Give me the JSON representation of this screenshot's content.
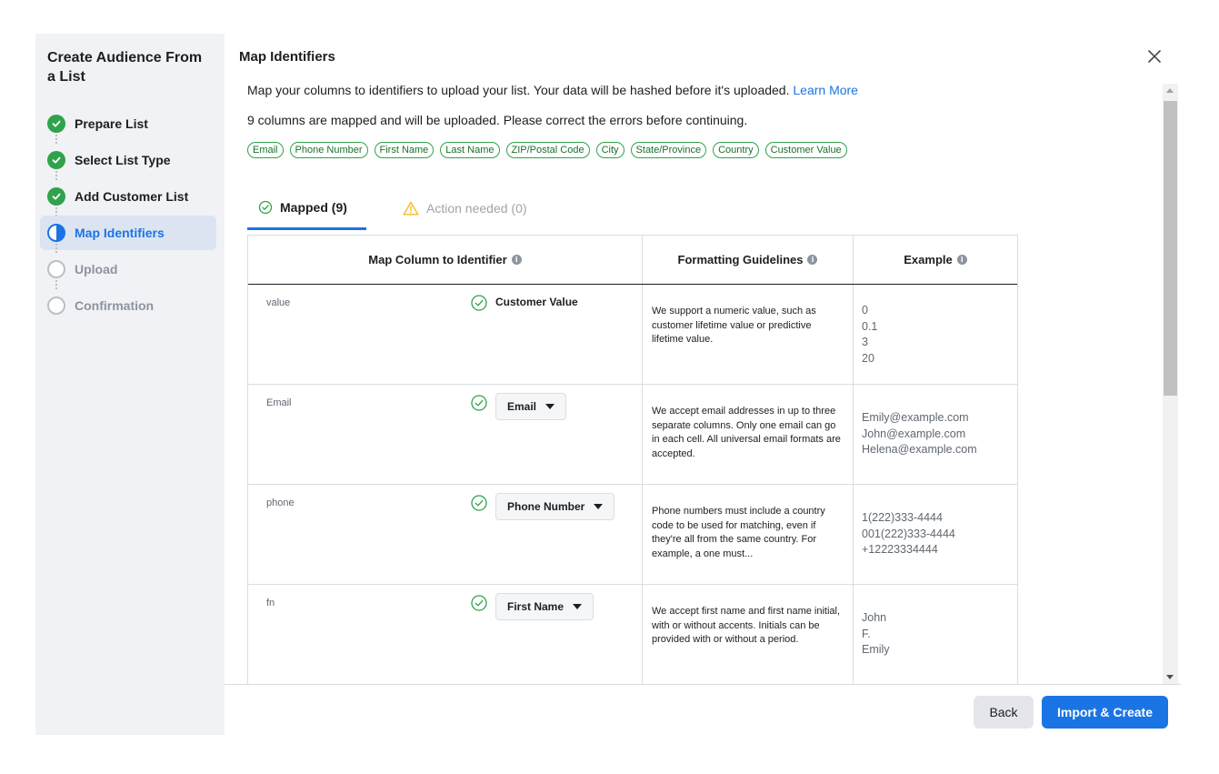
{
  "sidebar": {
    "title": "Create Audience From a List",
    "steps": [
      {
        "label": "Prepare List",
        "state": "done"
      },
      {
        "label": "Select List Type",
        "state": "done"
      },
      {
        "label": "Add Customer List",
        "state": "done"
      },
      {
        "label": "Map Identifiers",
        "state": "active"
      },
      {
        "label": "Upload",
        "state": "todo"
      },
      {
        "label": "Confirmation",
        "state": "todo"
      }
    ]
  },
  "main": {
    "title": "Map Identifiers",
    "description": "Map your columns to identifiers to upload your list. Your data will be hashed before it's uploaded.",
    "learn_more": "Learn More",
    "status": "9 columns are mapped and will be uploaded. Please correct the errors before continuing.",
    "chips": [
      "Email",
      "Phone Number",
      "First Name",
      "Last Name",
      "ZIP/Postal Code",
      "City",
      "State/Province",
      "Country",
      "Customer Value"
    ],
    "tabs": {
      "mapped": "Mapped (9)",
      "action": "Action needed (0)"
    },
    "table": {
      "headers": [
        "Map Column to Identifier",
        "Formatting Guidelines",
        "Example"
      ],
      "rows": [
        {
          "column": "value",
          "identifier": "Customer Value",
          "editable": false,
          "guideline": "We support a numeric value, such as customer lifetime value or predictive lifetime value.",
          "examples": [
            "0",
            "0.1",
            "3",
            "20"
          ]
        },
        {
          "column": "Email",
          "identifier": "Email",
          "editable": true,
          "guideline": "We accept email addresses in up to three separate columns. Only one email can go in each cell. All universal email formats are accepted.",
          "examples": [
            "Emily@example.com",
            "John@example.com",
            "Helena@example.com"
          ]
        },
        {
          "column": "phone",
          "identifier": "Phone Number",
          "editable": true,
          "guideline": "Phone numbers must include a country code to be used for matching, even if they're all from the same country. For example, a one must...",
          "examples": [
            "1(222)333-4444",
            "001(222)333-4444",
            "+12223334444"
          ]
        },
        {
          "column": "fn",
          "identifier": "First Name",
          "editable": true,
          "guideline": "We accept first name and first name initial, with or without accents. Initials can be provided with or without a period.",
          "examples": [
            "John",
            "F.",
            "Emily"
          ]
        }
      ]
    }
  },
  "footer": {
    "back_label": "Back",
    "primary_label": "Import & Create"
  },
  "colors": {
    "accent": "#1b74e4",
    "success": "#31a24c",
    "warning": "#f7b928"
  }
}
